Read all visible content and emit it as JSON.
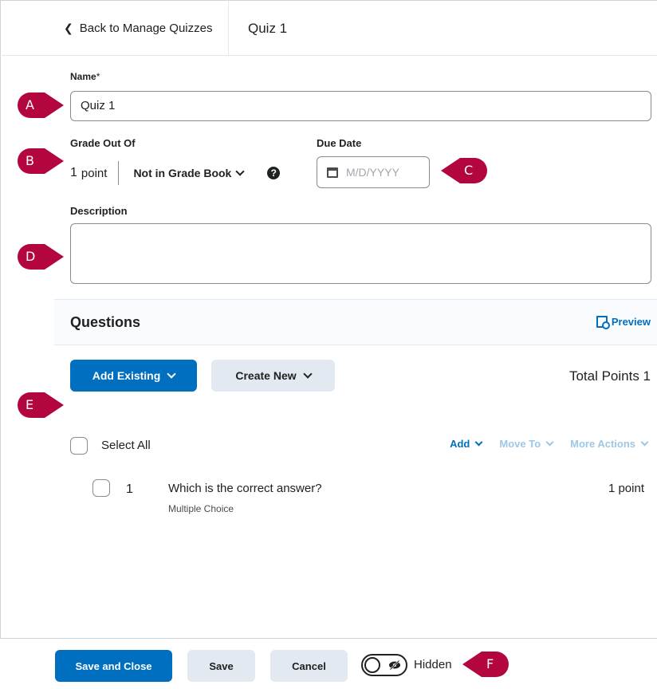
{
  "header": {
    "back_label": "Back to Manage Quizzes",
    "title": "Quiz 1"
  },
  "form": {
    "name_label": "Name",
    "required_mark": "*",
    "name_value": "Quiz 1",
    "grade_label": "Grade Out Of",
    "grade_value": "1",
    "grade_unit": "point",
    "grade_book_select": "Not in Grade Book",
    "help_glyph": "?",
    "due_date_label": "Due Date",
    "due_date_placeholder": "M/D/YYYY",
    "description_label": "Description"
  },
  "questions": {
    "title": "Questions",
    "preview_label": "Preview",
    "add_existing_label": "Add Existing",
    "create_new_label": "Create New",
    "total_points": "Total Points 1",
    "select_all_label": "Select All",
    "actions": [
      {
        "label": "Add",
        "enabled": true
      },
      {
        "label": "Move To",
        "enabled": false
      },
      {
        "label": "More Actions",
        "enabled": false
      }
    ],
    "items": [
      {
        "number": "1",
        "text": "Which is the correct answer?",
        "type": "Multiple Choice",
        "points": "1 point"
      }
    ]
  },
  "footer": {
    "save_close_label": "Save and Close",
    "save_label": "Save",
    "cancel_label": "Cancel",
    "visibility_label": "Hidden"
  },
  "callouts": [
    "A",
    "B",
    "C",
    "D",
    "E",
    "F"
  ],
  "colors": {
    "primary": "#006fbf",
    "secondary_bg": "#e3e9f1",
    "callout": "#b3063f",
    "text": "#202122"
  },
  "icons": [
    "chevron-left-icon",
    "chevron-down-icon",
    "help-icon",
    "calendar-icon",
    "preview-icon",
    "eye-slash-icon"
  ]
}
